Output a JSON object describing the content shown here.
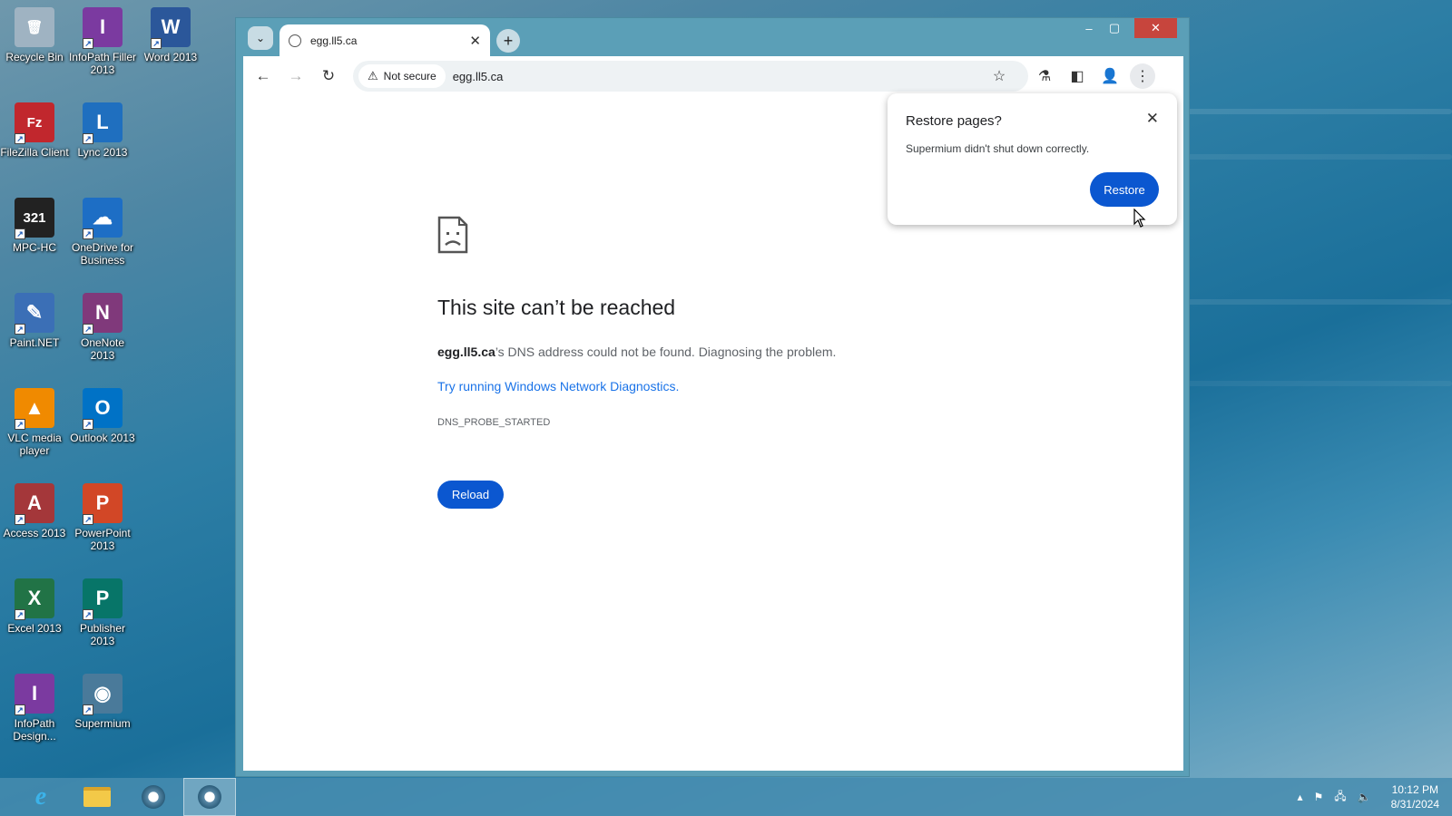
{
  "desktop": {
    "icons": [
      {
        "label": "Recycle Bin",
        "color": "#9fb3c2",
        "glyph": "🗑"
      },
      {
        "label": "InfoPath Filler 2013",
        "color": "#7b3aa0",
        "glyph": "I"
      },
      {
        "label": "Word 2013",
        "color": "#2b579a",
        "glyph": "W"
      },
      {
        "label": "FileZilla Client",
        "color": "#c1272d",
        "glyph": "Fz"
      },
      {
        "label": "Lync 2013",
        "color": "#1f6fbf",
        "glyph": "L"
      },
      {
        "label": "MPC-HC",
        "color": "#222222",
        "glyph": "321"
      },
      {
        "label": "OneDrive for Business",
        "color": "#1d6ec5",
        "glyph": "☁"
      },
      {
        "label": "Paint.NET",
        "color": "#3b6fb6",
        "glyph": "✎"
      },
      {
        "label": "OneNote 2013",
        "color": "#80397b",
        "glyph": "N"
      },
      {
        "label": "VLC media player",
        "color": "#f08a00",
        "glyph": "▲"
      },
      {
        "label": "Outlook 2013",
        "color": "#0072c6",
        "glyph": "O"
      },
      {
        "label": "Access 2013",
        "color": "#a4373a",
        "glyph": "A"
      },
      {
        "label": "PowerPoint 2013",
        "color": "#d24726",
        "glyph": "P"
      },
      {
        "label": "Excel 2013",
        "color": "#217346",
        "glyph": "X"
      },
      {
        "label": "Publisher 2013",
        "color": "#077568",
        "glyph": "P"
      },
      {
        "label": "InfoPath Design...",
        "color": "#7b3aa0",
        "glyph": "I"
      },
      {
        "label": "Supermium",
        "color": "#4a7a9a",
        "glyph": "◉"
      }
    ]
  },
  "browser": {
    "tab": {
      "title": "egg.ll5.ca",
      "close_icon": "close-icon"
    },
    "window_controls": {
      "minimize": "–",
      "maximize": "▢",
      "close": "✕"
    },
    "toolbar": {
      "back": "←",
      "forward": "→",
      "reload": "↻",
      "security_label": "Not secure",
      "url": "egg.ll5.ca",
      "star": "☆",
      "labs": "⚗",
      "sidepanel": "◧",
      "profile": "👤",
      "menu": "⋮"
    },
    "error": {
      "title": "This site can’t be reached",
      "host": "egg.ll5.ca",
      "desc_rest": "’s DNS address could not be found. Diagnosing the problem.",
      "link": "Try running Windows Network Diagnostics.",
      "code": "DNS_PROBE_STARTED",
      "reload_label": "Reload"
    },
    "popup": {
      "title": "Restore pages?",
      "message": "Supermium didn't shut down correctly.",
      "button": "Restore",
      "close": "✕"
    }
  },
  "taskbar": {
    "items": [
      "ie-icon",
      "file-explorer-icon",
      "supermium-icon",
      "supermium-icon"
    ],
    "time": "10:12 PM",
    "date": "8/31/2024"
  }
}
